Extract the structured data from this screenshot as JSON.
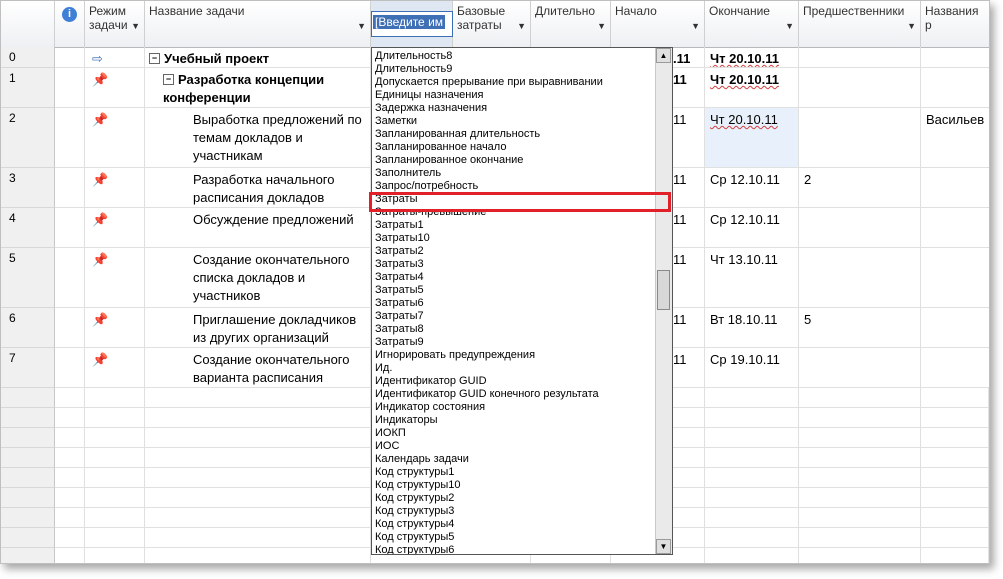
{
  "header": {
    "mode_label_line1": "Режим",
    "mode_label_line2": "задачи",
    "task_name": "Название задачи",
    "editor_text": "[Введите им",
    "base_cost_line1": "Базовые",
    "base_cost_line2": "затраты",
    "duration": "Длительно",
    "start": "Начало",
    "end": "Окончание",
    "predecessors": "Предшественники",
    "resources": "Названия р"
  },
  "rows": [
    {
      "num": "0",
      "name": "Учебный проект",
      "finish": "Чт 20.10.11",
      "start_tail": ".11",
      "pred": "",
      "res": ""
    },
    {
      "num": "1",
      "name": "Разработка концепции конференции",
      "finish": "Чт 20.10.11",
      "start_tail": "11",
      "pred": "",
      "res": ""
    },
    {
      "num": "2",
      "name": "Выработка предложений по темам докладов и участникам",
      "finish": "Чт 20.10.11",
      "start_tail": "11",
      "pred": "",
      "res": "Васильев"
    },
    {
      "num": "3",
      "name": "Разработка начального расписания докладов",
      "finish": "Ср 12.10.11",
      "start_tail": "11",
      "pred": "2",
      "res": ""
    },
    {
      "num": "4",
      "name": "Обсуждение предложений",
      "finish": "Ср 12.10.11",
      "start_tail": "11",
      "pred": "",
      "res": ""
    },
    {
      "num": "5",
      "name": "Создание окончательного списка докладов и участников",
      "finish": "Чт 13.10.11",
      "start_tail": "11",
      "pred": "",
      "res": ""
    },
    {
      "num": "6",
      "name": "Приглашение докладчиков из других организаций",
      "finish": "Вт 18.10.11",
      "start_tail": "11",
      "pred": "5",
      "res": ""
    },
    {
      "num": "7",
      "name": "Создание окончательного варианта расписания",
      "finish": "Ср 19.10.11",
      "start_tail": "11",
      "pred": "",
      "res": ""
    }
  ],
  "dropdown_items": [
    "Длительность8",
    "Длительность9",
    "Допускается прерывание при выравнивании",
    "Единицы назначения",
    "Задержка назначения",
    "Заметки",
    "Запланированная длительность",
    "Запланированное начало",
    "Запланированное окончание",
    "Заполнитель",
    "Запрос/потребность",
    "Затраты",
    "Затраты-превышение",
    "Затраты1",
    "Затраты10",
    "Затраты2",
    "Затраты3",
    "Затраты4",
    "Затраты5",
    "Затраты6",
    "Затраты7",
    "Затраты8",
    "Затраты9",
    "Игнорировать предупреждения",
    "Ид.",
    "Идентификатор GUID",
    "Идентификатор GUID конечного результата",
    "Индикатор состояния",
    "Индикаторы",
    "ИОКП",
    "ИОС",
    "Календарь задачи",
    "Код структуры1",
    "Код структуры10",
    "Код структуры2",
    "Код структуры3",
    "Код структуры4",
    "Код структуры5",
    "Код структуры6"
  ],
  "icons": {
    "info": "info-icon",
    "pin": "pushpin-icon",
    "summary": "summary-task-icon"
  },
  "colors": {
    "highlight": "#e2202a",
    "selection": "#3f6fb5"
  }
}
